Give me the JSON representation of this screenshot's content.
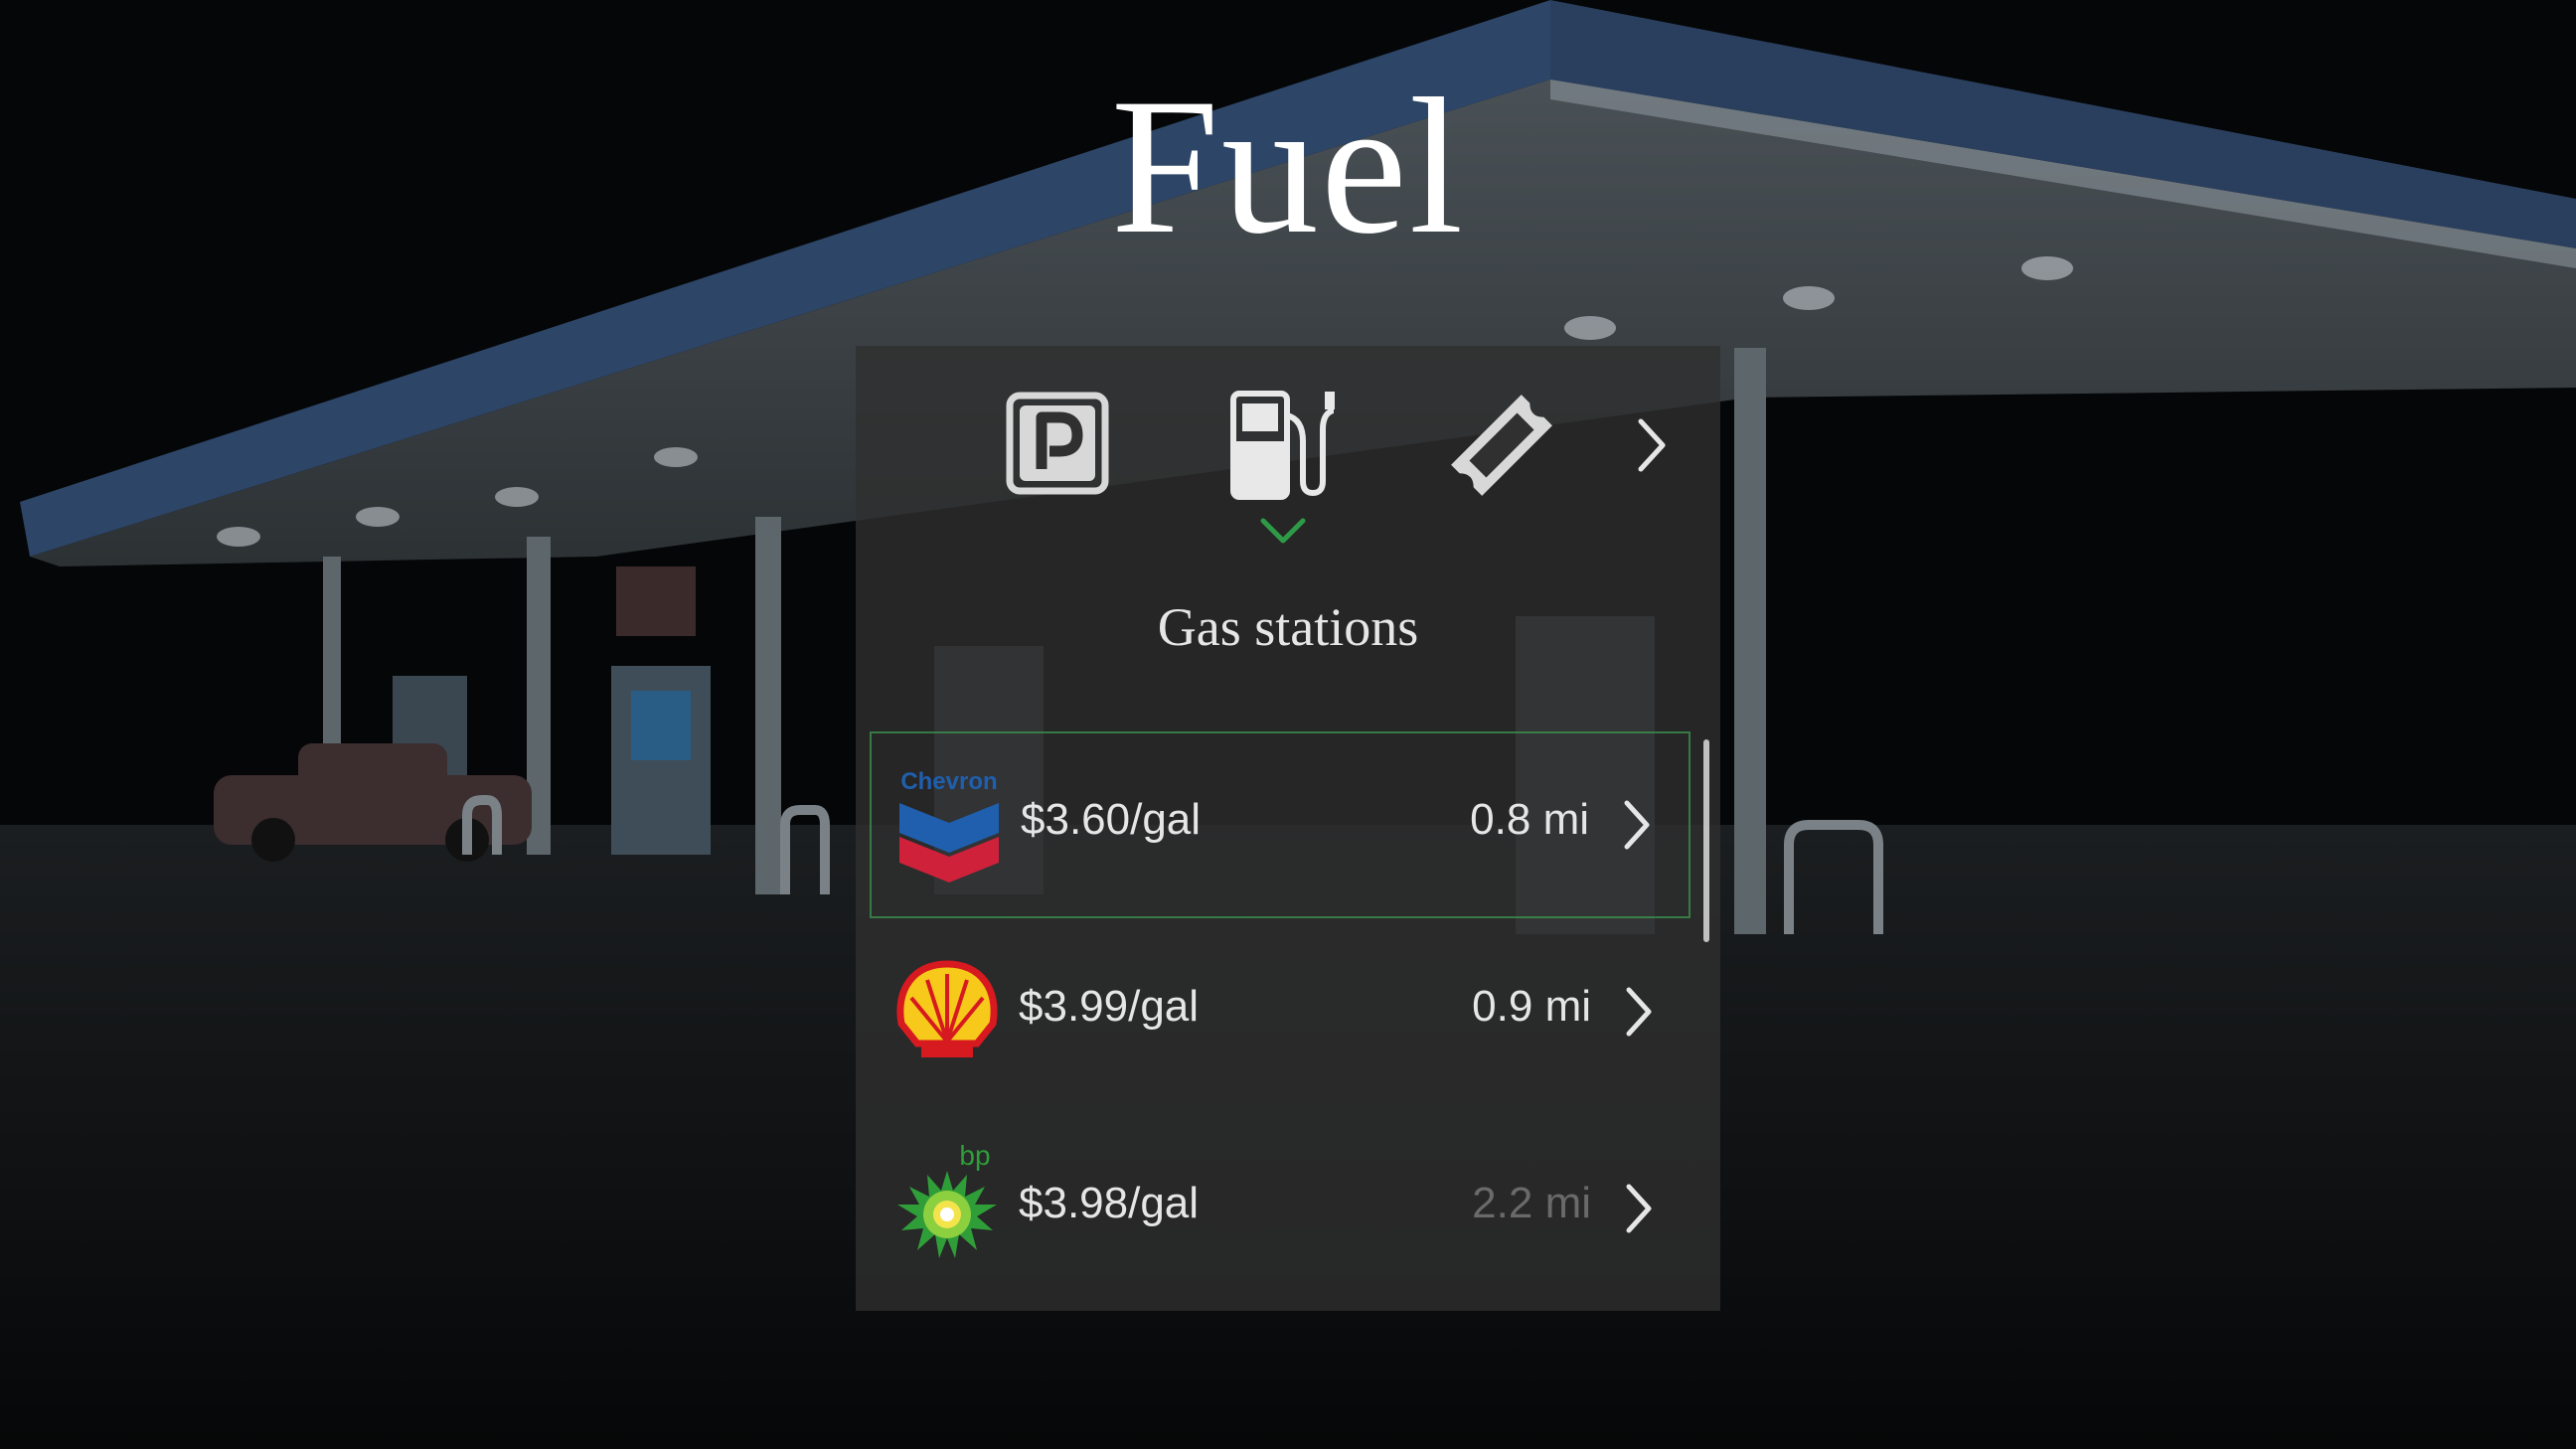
{
  "app": {
    "title": "Fuel"
  },
  "categories": [
    {
      "name": "parking",
      "icon": "parking-icon",
      "selected": false
    },
    {
      "name": "fuel",
      "icon": "fuel-pump-icon",
      "selected": true
    },
    {
      "name": "tickets",
      "icon": "ticket-icon",
      "selected": false
    },
    {
      "name": "more",
      "icon": "chevron-right-icon",
      "selected": false
    }
  ],
  "section": {
    "title": "Gas stations"
  },
  "stations": [
    {
      "brand": "Chevron",
      "logo": "chevron-logo",
      "logo_text": "Chevron",
      "price": "$3.60/gal",
      "distance": "0.8 mi",
      "focused": true,
      "dim_distance": false
    },
    {
      "brand": "Shell",
      "logo": "shell-logo",
      "price": "$3.99/gal",
      "distance": "0.9 mi",
      "focused": false,
      "dim_distance": false
    },
    {
      "brand": "bp",
      "logo": "bp-logo",
      "logo_text": "bp",
      "price": "$3.98/gal",
      "distance": "2.2 mi",
      "focused": false,
      "dim_distance": true
    }
  ],
  "colors": {
    "accent_green": "#2e9a48",
    "panel": "#303030",
    "text": "#e6e6e6",
    "dim_text": "#6a6a6a",
    "chevron_blue": "#1f5fae",
    "chevron_red": "#d0213b",
    "shell_yellow": "#f7c91a",
    "shell_red": "#d71920",
    "bp_green": "#2f9e39"
  }
}
